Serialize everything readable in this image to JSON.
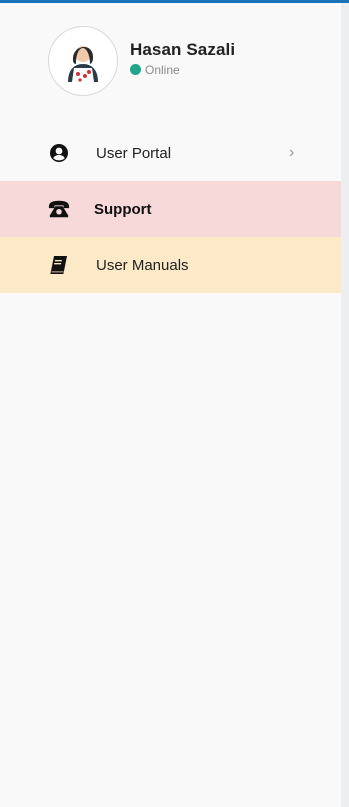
{
  "user": {
    "name": "Hasan Sazali",
    "status": "Online",
    "status_color": "#20a58a"
  },
  "menu": {
    "items": [
      {
        "label": "User Portal",
        "icon": "user-circle-icon",
        "has_submenu": true,
        "chevron": "›"
      },
      {
        "label": "Support",
        "icon": "telephone-icon",
        "active": true,
        "bg": "#f7d9d9"
      },
      {
        "label": "User Manuals",
        "icon": "book-icon",
        "bg": "#fbe9c7"
      }
    ]
  },
  "colors": {
    "accent_bar": "#1a73b8",
    "sidebar_bg": "#f9f9f9"
  }
}
